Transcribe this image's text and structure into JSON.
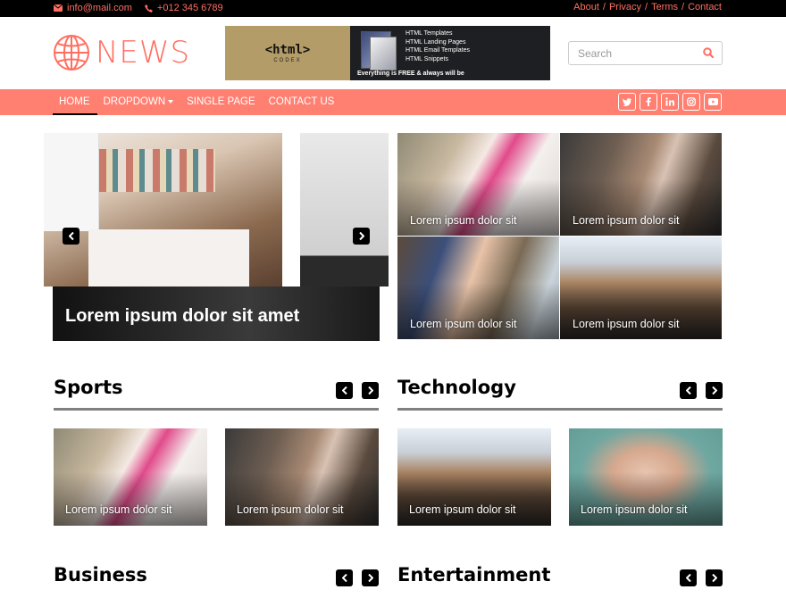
{
  "topbar": {
    "email": "info@mail.com",
    "phone": "+012 345 6789",
    "links": [
      "About",
      "Privacy",
      "Terms",
      "Contact"
    ],
    "separator": "/"
  },
  "brand": {
    "logo_text": "NEWS"
  },
  "ad_banner": {
    "title": "<html>",
    "subtitle": "CODEX",
    "items": [
      "HTML Templates",
      "HTML Landing Pages",
      "HTML Email Templates",
      "HTML Snippets"
    ],
    "tagline": "Everything is FREE & always will be"
  },
  "search": {
    "placeholder": "Search"
  },
  "nav": {
    "items": [
      {
        "label": "HOME",
        "active": true
      },
      {
        "label": "DROPDOWN",
        "has_caret": true
      },
      {
        "label": "SINGLE PAGE"
      },
      {
        "label": "CONTACT US"
      }
    ],
    "social": [
      "twitter-icon",
      "facebook-icon",
      "linkedin-icon",
      "instagram-icon",
      "youtube-icon"
    ]
  },
  "main_slider": {
    "caption": "Lorem ipsum dolor sit amet"
  },
  "top_news": [
    {
      "caption": "Lorem ipsum dolor sit"
    },
    {
      "caption": "Lorem ipsum dolor sit"
    },
    {
      "caption": "Lorem ipsum dolor sit"
    },
    {
      "caption": "Lorem ipsum dolor sit"
    }
  ],
  "sections": {
    "sports": {
      "title": "Sports",
      "cards": [
        {
          "caption": "Lorem ipsum dolor sit"
        },
        {
          "caption": "Lorem ipsum dolor sit"
        }
      ]
    },
    "technology": {
      "title": "Technology",
      "cards": [
        {
          "caption": "Lorem ipsum dolor sit"
        },
        {
          "caption": "Lorem ipsum dolor sit"
        }
      ]
    },
    "business": {
      "title": "Business"
    },
    "entertainment": {
      "title": "Entertainment"
    }
  },
  "colors": {
    "accent": "#ff7f71",
    "topbar_bg": "#000000",
    "divider": "#808080"
  }
}
